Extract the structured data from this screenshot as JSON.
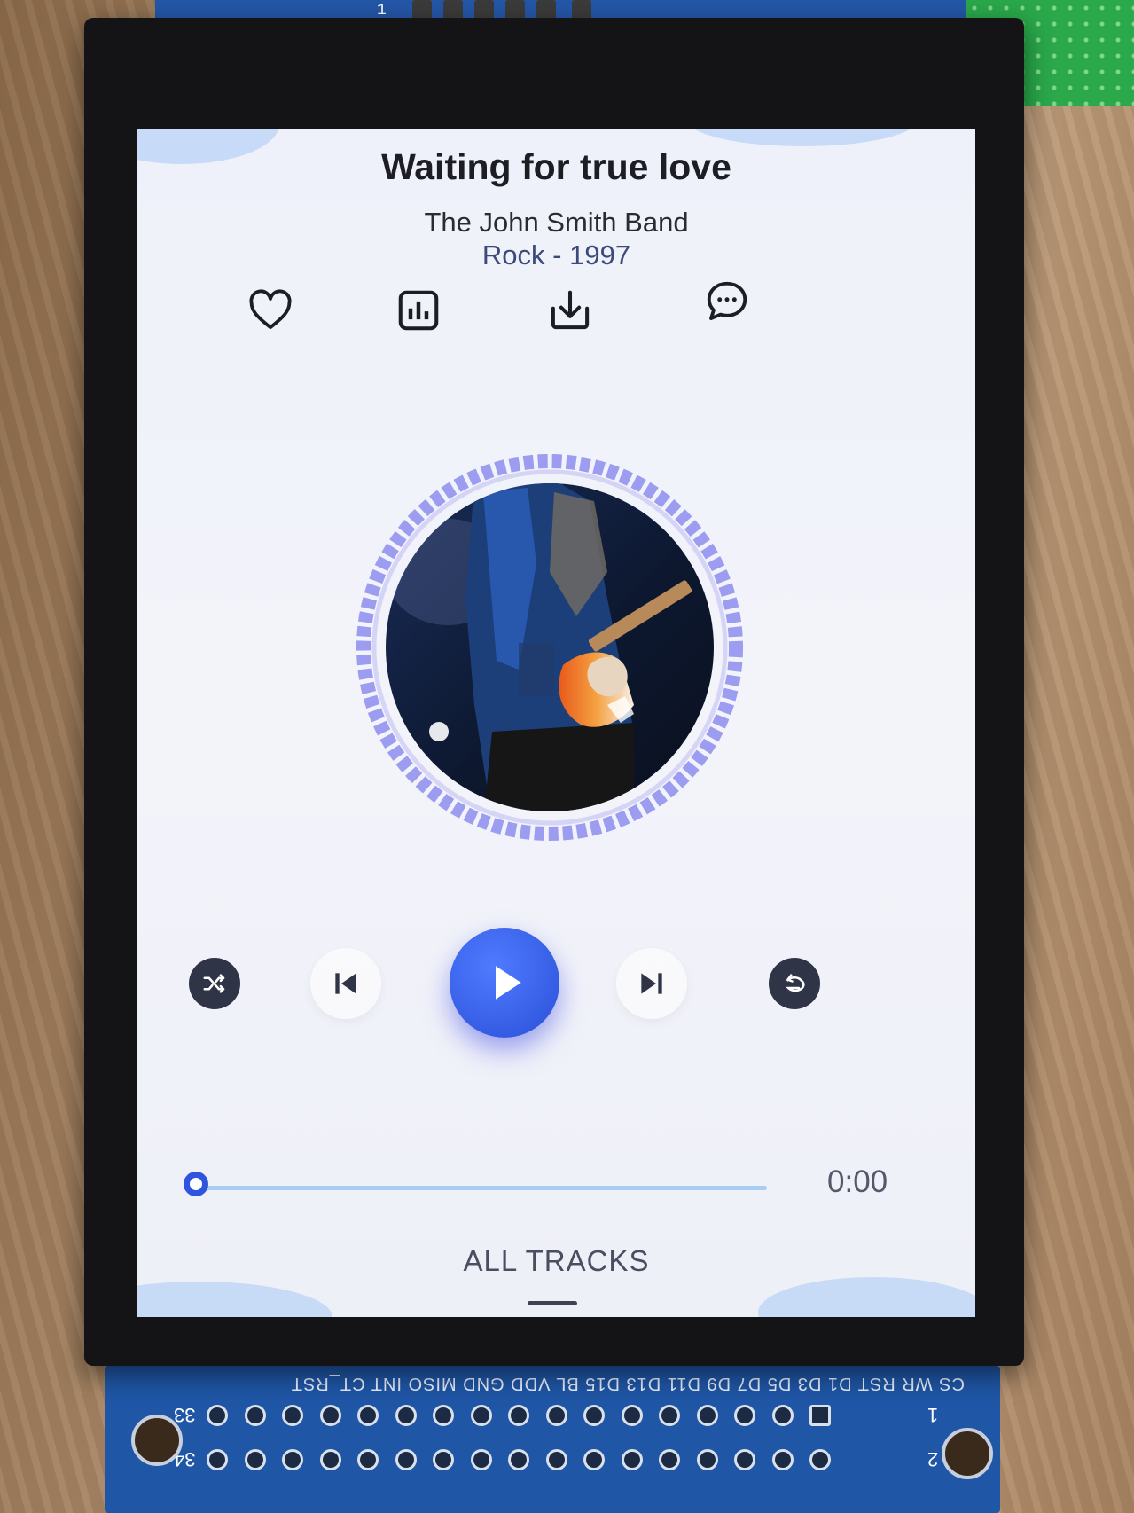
{
  "track": {
    "title": "Waiting for true love",
    "artist": "The John Smith Band",
    "genre_year": "Rock - 1997"
  },
  "actions": [
    {
      "name": "like",
      "icon": "heart-icon"
    },
    {
      "name": "equalizer",
      "icon": "bar-chart-icon"
    },
    {
      "name": "download",
      "icon": "download-icon"
    },
    {
      "name": "comments",
      "icon": "chat-bubble-icon"
    }
  ],
  "controls": {
    "shuffle_icon": "shuffle-icon",
    "previous_icon": "skip-previous-icon",
    "play_icon": "play-icon",
    "next_icon": "skip-next-icon",
    "repeat_icon": "repeat-icon"
  },
  "progress": {
    "time": "0:00",
    "fraction": 0
  },
  "all_tracks_label": "ALL TRACKS",
  "board": {
    "pin_labels": "CS WR RST D1 D3 D5 D7 D9 D11 D13 D15 BL VDD GND MISO INT CT_RST",
    "pin1": "1",
    "pin2": "2",
    "pin33": "33",
    "pin34": "34",
    "top_pin": "1"
  },
  "colors": {
    "accent": "#2f55e0",
    "ring": "#9c9cf0",
    "progress_track": "#a9ccf3",
    "dark_button": "#2f3446"
  }
}
